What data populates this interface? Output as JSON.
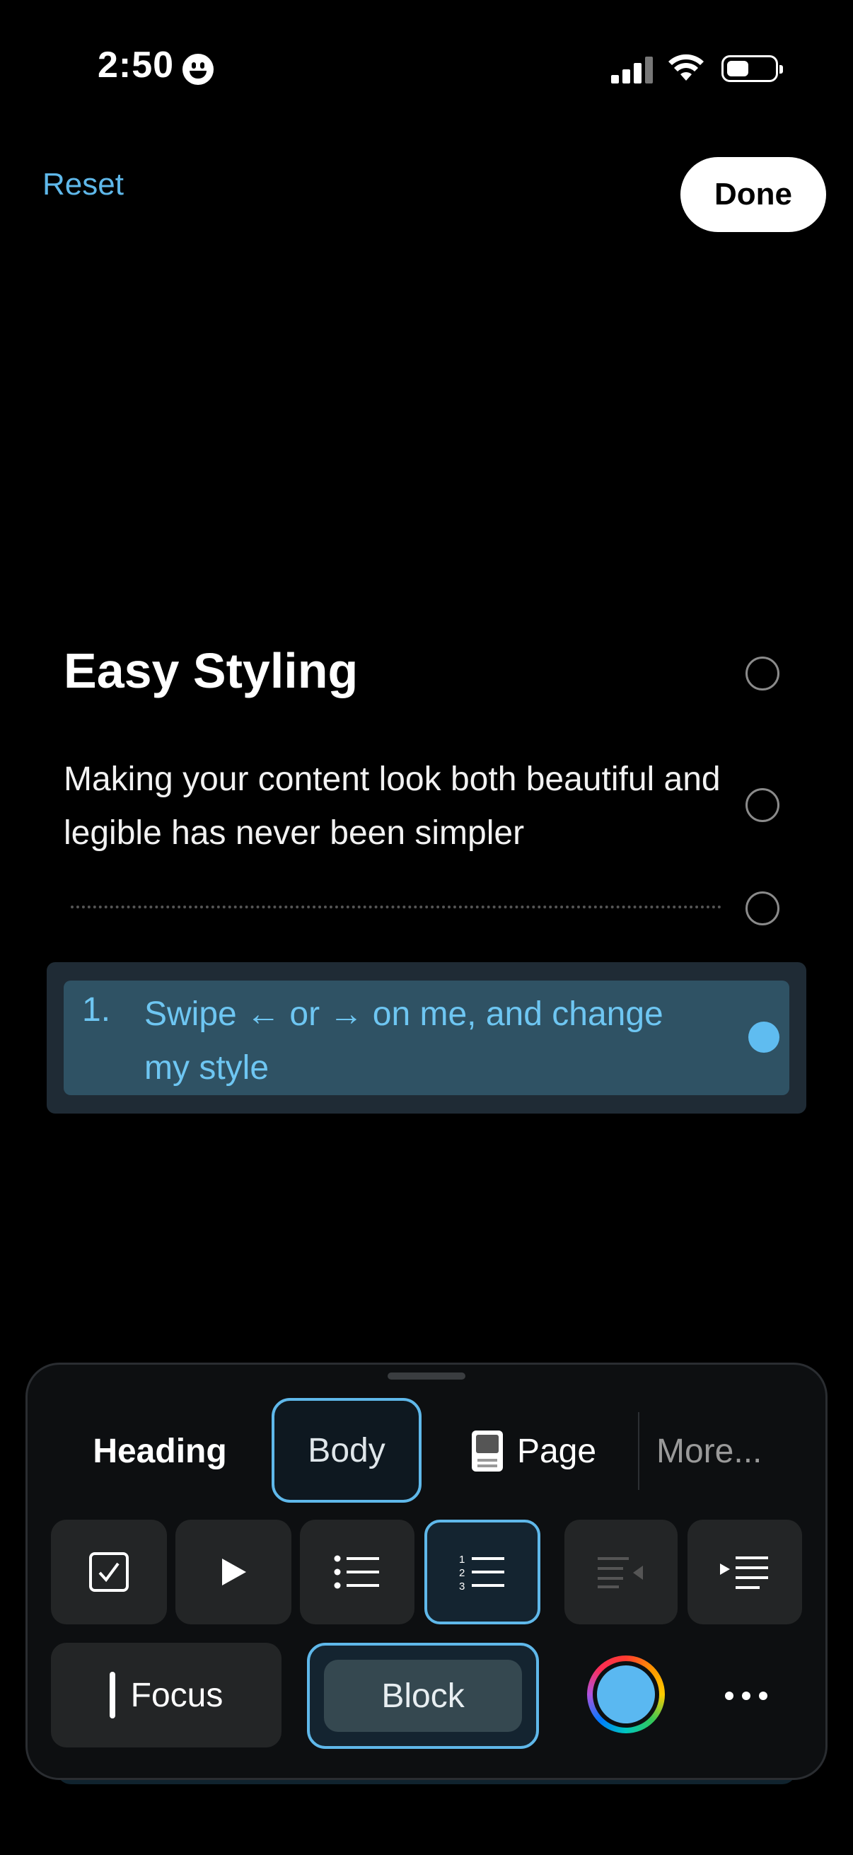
{
  "status_bar": {
    "time": "2:50",
    "icons": [
      "smiley-icon",
      "cellular-signal-icon",
      "wifi-icon",
      "battery-icon"
    ]
  },
  "nav": {
    "reset_label": "Reset",
    "done_label": "Done"
  },
  "content": {
    "heading": "Easy Styling",
    "body": "Making your content look both beautiful and legible has never been simpler",
    "list_item": {
      "number": "1.",
      "text": "Swipe ← or → on me, and change my style"
    }
  },
  "style_panel": {
    "tabs": [
      {
        "label": "Heading"
      },
      {
        "label": "Body",
        "selected": true
      },
      {
        "label": "Page",
        "icon": "page-icon"
      },
      {
        "label": "More..."
      }
    ],
    "tools": [
      {
        "icon": "checkbox-icon"
      },
      {
        "icon": "play-toggle-icon"
      },
      {
        "icon": "bullet-list-icon"
      },
      {
        "icon": "numbered-list-icon",
        "selected": true
      },
      {
        "icon": "outdent-icon",
        "disabled": true
      },
      {
        "icon": "indent-icon"
      }
    ],
    "focus_label": "Focus",
    "block_label": "Block",
    "accent_color": "#5ab8f1",
    "selection_color": "#5fb8ea"
  }
}
